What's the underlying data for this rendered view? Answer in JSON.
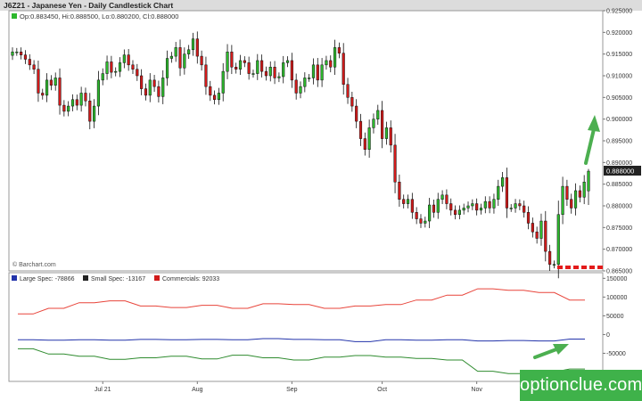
{
  "header": {
    "title": "J6Z21 - Japanese Yen - Daily Candlestick Chart",
    "ohlc": "Op:0.883450, Hi:0.888500, Lo:0.880200, Cl:0.888000"
  },
  "watermark": "© Barchart.com",
  "brand": "optionclue.com",
  "colors": {
    "up": "#2db82d",
    "down": "#d11a1a",
    "large_spec": "#2233aa",
    "small_spec": "#2e8b2e",
    "commercials": "#e8443a",
    "arrow": "#4caf50",
    "last_price_bg": "#222222"
  },
  "legend": [
    {
      "label": "Large Spec: -78866",
      "color": "#2233aa"
    },
    {
      "label": "Small Spec: -13167",
      "color": "#222222"
    },
    {
      "label": "Commercials: 92033",
      "color": "#d11a1a"
    }
  ],
  "last_price_label": "0.888000",
  "x_labels": [
    {
      "label": "Jul 21",
      "index": 21
    },
    {
      "label": "Aug",
      "index": 43
    },
    {
      "label": "Sep",
      "index": 65
    },
    {
      "label": "Oct",
      "index": 86
    },
    {
      "label": "Nov",
      "index": 108
    }
  ],
  "chart_data": [
    {
      "type": "candlestick",
      "title": "J6Z21 - Japanese Yen - Daily Candlestick Chart",
      "ylim": [
        0.865,
        0.925
      ],
      "yticks": [
        "0.865000",
        "0.870000",
        "0.875000",
        "0.880000",
        "0.885000",
        "0.890000",
        "0.895000",
        "0.900000",
        "0.905000",
        "0.910000",
        "0.915000",
        "0.920000",
        "0.925000"
      ],
      "grid": false,
      "closes": [
        0.9155,
        0.9155,
        0.9148,
        0.9138,
        0.9125,
        0.9115,
        0.906,
        0.9055,
        0.909,
        0.9078,
        0.9095,
        0.9032,
        0.9018,
        0.903,
        0.9045,
        0.9032,
        0.906,
        0.9042,
        0.8995,
        0.903,
        0.909,
        0.9105,
        0.9132,
        0.9108,
        0.911,
        0.913,
        0.9148,
        0.9125,
        0.9115,
        0.91,
        0.907,
        0.9055,
        0.909,
        0.9075,
        0.9052,
        0.9095,
        0.914,
        0.9145,
        0.9165,
        0.9118,
        0.915,
        0.916,
        0.9185,
        0.9145,
        0.9125,
        0.9075,
        0.9055,
        0.9045,
        0.906,
        0.911,
        0.9155,
        0.912,
        0.9115,
        0.9135,
        0.913,
        0.9105,
        0.9105,
        0.9135,
        0.911,
        0.91,
        0.912,
        0.9095,
        0.9098,
        0.913,
        0.9135,
        0.909,
        0.906,
        0.9075,
        0.9095,
        0.9095,
        0.9125,
        0.909,
        0.9125,
        0.9135,
        0.912,
        0.9165,
        0.9152,
        0.908,
        0.905,
        0.903,
        0.8995,
        0.8955,
        0.893,
        0.898,
        0.9,
        0.902,
        0.8955,
        0.898,
        0.894,
        0.8855,
        0.8815,
        0.8805,
        0.8815,
        0.8785,
        0.877,
        0.876,
        0.8765,
        0.8802,
        0.8785,
        0.8815,
        0.8825,
        0.8805,
        0.879,
        0.878,
        0.879,
        0.8795,
        0.88,
        0.8805,
        0.879,
        0.8795,
        0.881,
        0.8795,
        0.8815,
        0.8845,
        0.8865,
        0.8795,
        0.8795,
        0.8805,
        0.88,
        0.8785,
        0.876,
        0.874,
        0.8725,
        0.8765,
        0.8695,
        0.8665,
        0.8665,
        0.878,
        0.8845,
        0.8815,
        0.8795,
        0.8835,
        0.882,
        0.8855,
        0.888
      ],
      "last_candle": {
        "open": 0.88345,
        "high": 0.8885,
        "low": 0.8802,
        "close": 0.888
      }
    },
    {
      "type": "line",
      "title": "Commitment of Traders",
      "ylim": [
        -125000,
        165000
      ],
      "yticks": [
        "-100000",
        "-50000",
        "0",
        "50000",
        "100000",
        "150000"
      ],
      "series": [
        {
          "name": "Large Spec",
          "values": [
            -14000,
            -14000,
            -15000,
            -15000,
            -14000,
            -14000,
            -15000,
            -15000,
            -13000,
            -13000,
            -14000,
            -14000,
            -13000,
            -13000,
            -14000,
            -14000,
            -11000,
            -11000,
            -13000,
            -13000,
            -14000,
            -14000,
            -19000,
            -19000,
            -14000,
            -14000,
            -15000,
            -15000,
            -14000,
            -14000,
            -17000,
            -17000,
            -16000,
            -16000,
            -17000,
            -17000,
            -12000,
            -12000
          ]
        },
        {
          "name": "Small Spec",
          "values": [
            -38000,
            -38000,
            -52000,
            -52000,
            -58000,
            -58000,
            -66000,
            -66000,
            -62000,
            -62000,
            -58000,
            -58000,
            -65000,
            -65000,
            -55000,
            -55000,
            -62000,
            -62000,
            -68000,
            -68000,
            -60000,
            -60000,
            -56000,
            -56000,
            -60000,
            -60000,
            -64000,
            -64000,
            -68000,
            -68000,
            -98000,
            -98000,
            -104000,
            -104000,
            -100000,
            -100000,
            -92000,
            -92000
          ]
        },
        {
          "name": "Commercials",
          "values": [
            55000,
            55000,
            70000,
            70000,
            85000,
            85000,
            90000,
            90000,
            76000,
            76000,
            72000,
            72000,
            78000,
            78000,
            70000,
            70000,
            82000,
            82000,
            80000,
            80000,
            70000,
            70000,
            76000,
            76000,
            80000,
            80000,
            92000,
            92000,
            105000,
            105000,
            122000,
            122000,
            118000,
            118000,
            112000,
            112000,
            92000,
            92000
          ]
        }
      ]
    }
  ]
}
